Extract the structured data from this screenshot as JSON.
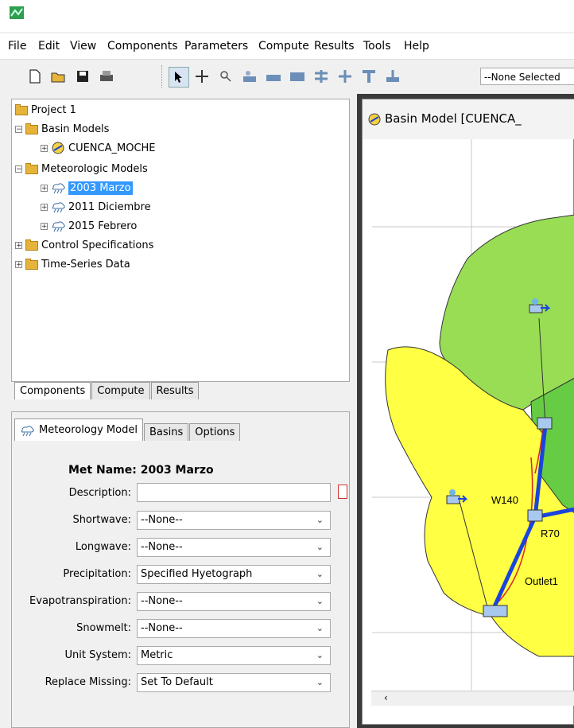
{
  "menu": [
    "File",
    "Edit",
    "View",
    "Components",
    "Parameters",
    "Compute",
    "Results",
    "Tools",
    "Help"
  ],
  "toolbar": {
    "selector_value": "--None Selected"
  },
  "tree": {
    "project": "Project 1",
    "basin_models": "Basin Models",
    "basin_item": "CUENCA_MOCHE",
    "met_models": "Meteorologic Models",
    "met_items": [
      "2003 Marzo",
      "2011 Diciembre",
      "2015 Febrero"
    ],
    "control": "Control Specifications",
    "timeseries": "Time-Series Data"
  },
  "bottom_tabs": [
    "Components",
    "Compute",
    "Results"
  ],
  "props_tabs": [
    "Meteorology Model",
    "Basins",
    "Options"
  ],
  "met": {
    "name_label": "Met Name:",
    "name_value": "2003 Marzo",
    "fields": [
      {
        "label": "Description:",
        "value": ""
      },
      {
        "label": "Shortwave:",
        "value": "--None--"
      },
      {
        "label": "Longwave:",
        "value": "--None--"
      },
      {
        "label": "Precipitation:",
        "value": "Specified Hyetograph"
      },
      {
        "label": "Evapotranspiration:",
        "value": "--None--"
      },
      {
        "label": "Snowmelt:",
        "value": "--None--"
      },
      {
        "label": "Unit System:",
        "value": "Metric"
      },
      {
        "label": "Replace Missing:",
        "value": "Set To Default"
      }
    ]
  },
  "basin_window": {
    "title": "Basin Model [CUENCA_",
    "labels": {
      "w140": "W140",
      "r70": "R70",
      "outlet": "Outlet1"
    }
  },
  "icons": [
    "app-icon",
    "new-file-icon",
    "open-folder-icon",
    "save-icon",
    "print-icon",
    "arrow-cursor-icon",
    "move-icon",
    "zoom-icon",
    "subbasin-tool-icon",
    "reach-tool-icon",
    "reservoir-tool-icon",
    "junction-tool-icon",
    "diversion-tool-icon",
    "source-tool-icon",
    "sink-tool-icon"
  ],
  "colors": {
    "selection": "#3399ff",
    "basin_light": "#99dd55",
    "basin_mid": "#66cc44",
    "basin_yellow": "#ffff44",
    "reach": "#1a44dd"
  }
}
